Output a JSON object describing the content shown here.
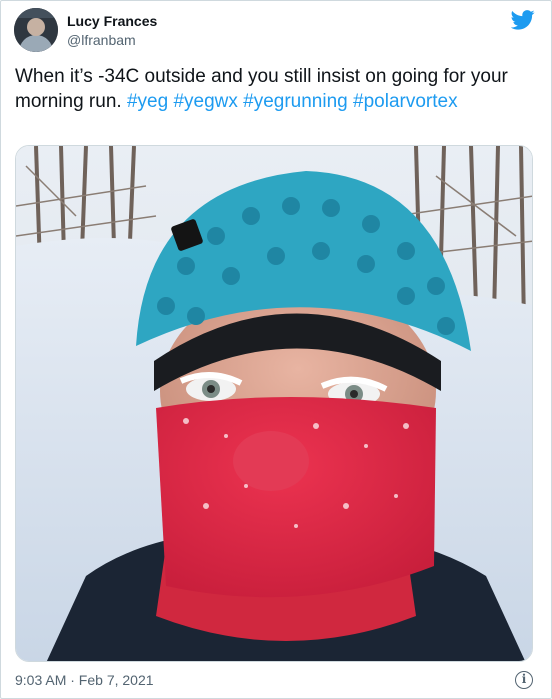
{
  "author": {
    "display_name": "Lucy Frances",
    "handle": "@lfranbam"
  },
  "tweet": {
    "text_prefix": "When it’s -34C outside and you still insist on going for your morning run. ",
    "hashtags": [
      "#yeg",
      "#yegwx",
      "#yegrunning",
      "#polarvortex"
    ],
    "timestamp": "9:03 AM · Feb 7, 2021"
  },
  "icons": {
    "brand": "twitter-bird-icon",
    "info": "info-icon"
  },
  "colors": {
    "link": "#1d9bf0",
    "brand": "#1d9bf0",
    "secondary_text": "#536471"
  }
}
